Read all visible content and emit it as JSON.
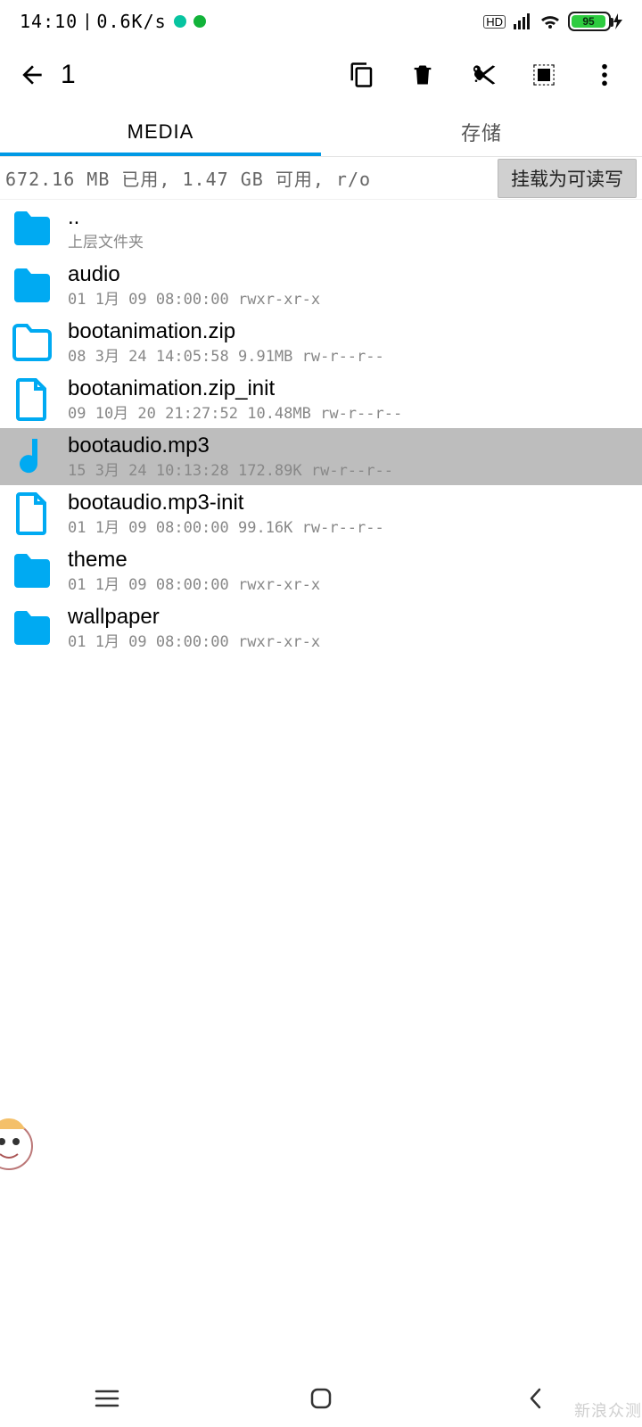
{
  "status": {
    "time": "14:10",
    "net_speed": "0.6K/s",
    "hd": "HD",
    "battery_pct": "95"
  },
  "toolbar": {
    "title": "1"
  },
  "tabs": {
    "media": "MEDIA",
    "storage": "存储"
  },
  "infobar": {
    "text": "672.16 MB 已用, 1.47 GB 可用, r/o",
    "mount_label": "挂载为可读写"
  },
  "files": [
    {
      "name": "..",
      "sub": "上层文件夹",
      "icon": "folder",
      "selected": false
    },
    {
      "name": "audio",
      "date": "01 1月 09 08:00:00",
      "perm": "rwxr-xr-x",
      "icon": "folder",
      "selected": false
    },
    {
      "name": "bootanimation.zip",
      "date": "08 3月 24 14:05:58",
      "size": "9.91MB",
      "perm": "rw-r--r--",
      "icon": "folder-outline",
      "selected": false
    },
    {
      "name": "bootanimation.zip_init",
      "date": "09 10月 20 21:27:52",
      "size": "10.48MB",
      "perm": "rw-r--r--",
      "icon": "file",
      "selected": false
    },
    {
      "name": "bootaudio.mp3",
      "date": "15 3月 24 10:13:28",
      "size": "172.89K",
      "perm": "rw-r--r--",
      "icon": "music",
      "selected": true
    },
    {
      "name": "bootaudio.mp3-init",
      "date": "01 1月 09 08:00:00",
      "size": "99.16K",
      "perm": "rw-r--r--",
      "icon": "file",
      "selected": false
    },
    {
      "name": "theme",
      "date": "01 1月 09 08:00:00",
      "perm": "rwxr-xr-x",
      "icon": "folder",
      "selected": false
    },
    {
      "name": "wallpaper",
      "date": "01 1月 09 08:00:00",
      "perm": "rwxr-xr-x",
      "icon": "folder",
      "selected": false
    }
  ],
  "watermark": "新浪众测"
}
